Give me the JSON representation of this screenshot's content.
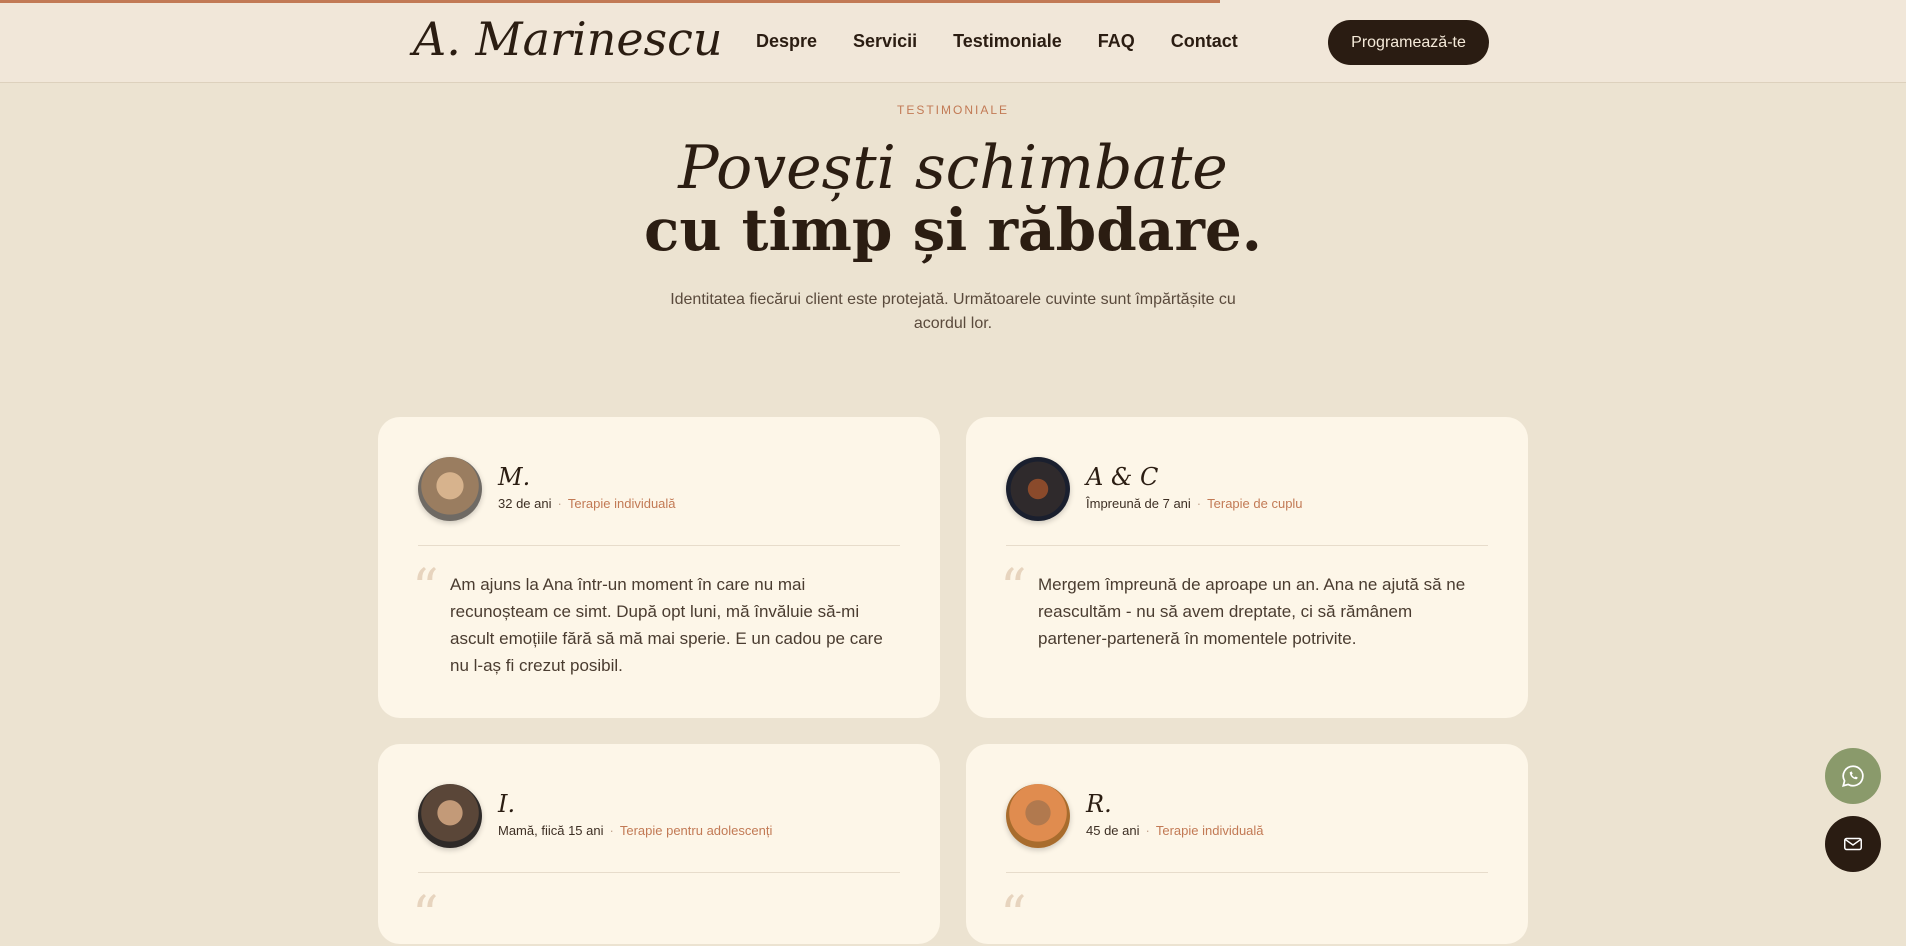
{
  "progress": {
    "fraction": 0.64,
    "color": "#c27a55"
  },
  "brand": {
    "logo": "A. Marinescu"
  },
  "nav": {
    "items": [
      "Despre",
      "Servicii",
      "Testimoniale",
      "FAQ",
      "Contact"
    ],
    "cta_label": "Programează-te"
  },
  "hero": {
    "kicker": "TESTIMONIALE",
    "title_line1": "Povești schimbate",
    "title_line2": "cu timp și răbdare.",
    "subtitle": "Identitatea fiecărui client este protejată. Următoarele cuvinte sunt împărtășite cu acordul lor."
  },
  "testimonials": [
    {
      "name": "M.",
      "age": "32 de ani",
      "therapy": "Terapie individuală",
      "quote": "Am ajuns la Ana într-un moment în care nu mai recunoșteam ce simt. După opt luni, mă învăluie să-mi ascult emoțiile fără să mă mai sperie. E un cadou pe care nu l-aș fi crezut posibil."
    },
    {
      "name": "A & C",
      "age": "Împreună de 7 ani",
      "therapy": "Terapie de cuplu",
      "quote": "Mergem împreună de aproape un an. Ana ne ajută să ne reascultăm - nu să avem dreptate, ci să rămânem partener-parteneră în momentele potrivite."
    },
    {
      "name": "I.",
      "age": "Mamă, fiică 15 ani",
      "therapy": "Terapie pentru adolescenți",
      "quote": ""
    },
    {
      "name": "R.",
      "age": "45 de ani",
      "therapy": "Terapie individuală",
      "quote": ""
    }
  ],
  "colors": {
    "accent": "#c27a55",
    "dark": "#2a1c12",
    "background": "#ece3d1",
    "card": "#fdf6e8",
    "whatsapp": "#8a9a6b"
  },
  "icons": {
    "whatsapp": "whatsapp-icon",
    "mail": "mail-icon",
    "quote": "quote-icon"
  }
}
